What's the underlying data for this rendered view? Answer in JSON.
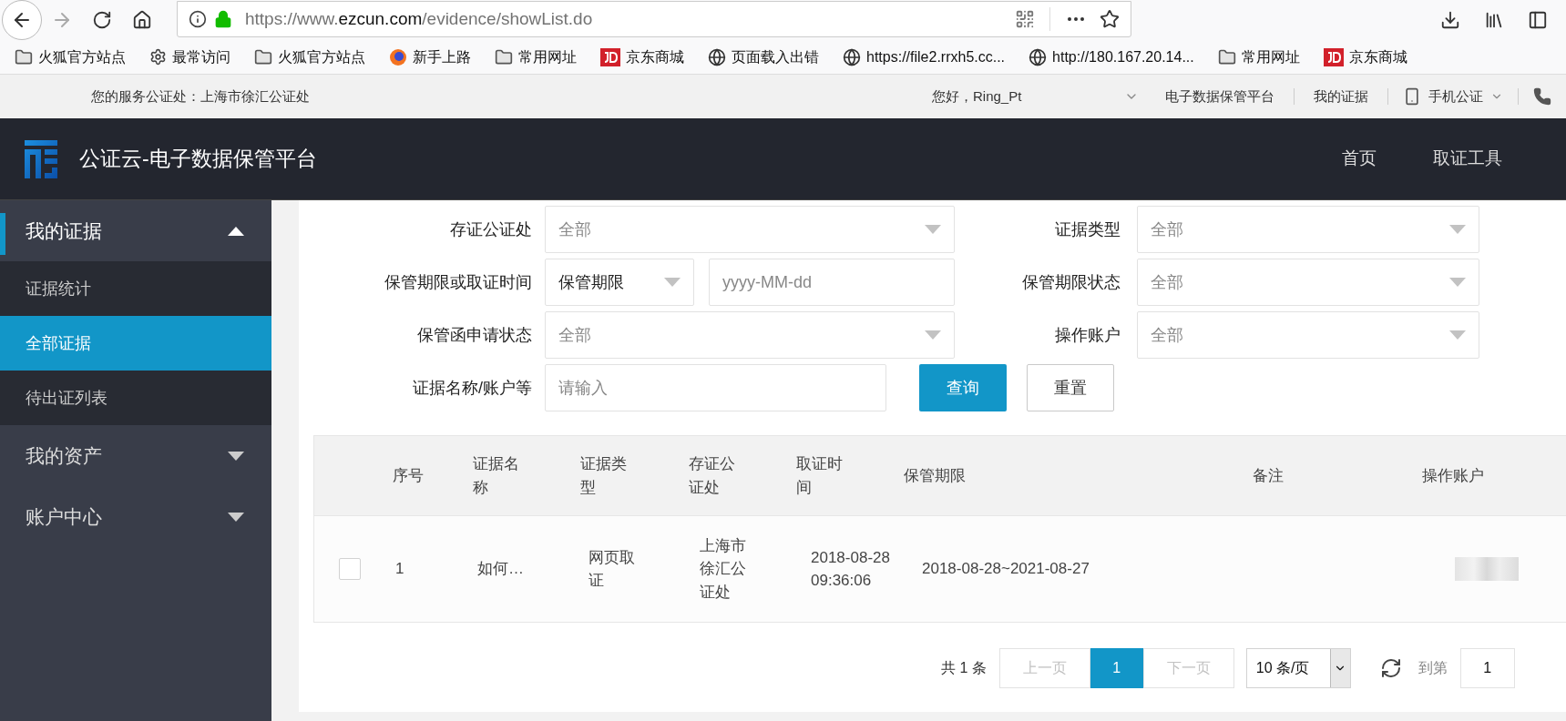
{
  "browser": {
    "back_enabled": true,
    "forward_enabled": false,
    "url": {
      "prefix": "https://www.",
      "domain": "ezcun.com",
      "path": "/evidence/showList.do"
    },
    "bookmarks": [
      {
        "kind": "folder",
        "label": "火狐官方站点"
      },
      {
        "kind": "gear",
        "label": "最常访问"
      },
      {
        "kind": "folder",
        "label": "火狐官方站点"
      },
      {
        "kind": "firefox",
        "label": "新手上路"
      },
      {
        "kind": "folder",
        "label": "常用网址"
      },
      {
        "kind": "jd",
        "label": "京东商城"
      },
      {
        "kind": "globe",
        "label": "页面载入出错"
      },
      {
        "kind": "globe",
        "label": "https://file2.rrxh5.cc..."
      },
      {
        "kind": "globe",
        "label": "http://180.167.20.14..."
      },
      {
        "kind": "folder",
        "label": "常用网址"
      },
      {
        "kind": "jd",
        "label": "京东商城"
      }
    ]
  },
  "topbar": {
    "service": "您的服务公证处：上海市徐汇公证处",
    "greeting": "您好，Ring_Pt",
    "links": [
      "电子数据保管平台",
      "我的证据"
    ],
    "mobile": "手机公证"
  },
  "header": {
    "title": "公证云-电子数据保管平台",
    "nav": [
      "首页",
      "取证工具"
    ]
  },
  "sidebar": [
    {
      "label": "我的证据",
      "expanded": true,
      "children": [
        {
          "label": "证据统计",
          "selected": false
        },
        {
          "label": "全部证据",
          "selected": true
        },
        {
          "label": "待出证列表",
          "selected": false
        }
      ]
    },
    {
      "label": "我的资产",
      "expanded": false
    },
    {
      "label": "账户中心",
      "expanded": false
    }
  ],
  "filters": [
    [
      {
        "label": "存证公证处",
        "kind": "select",
        "placeholder": "全部"
      },
      {
        "label": "证据类型",
        "kind": "select",
        "placeholder": "全部"
      }
    ],
    [
      {
        "label": "保管期限或取证时间",
        "kind": "combo",
        "value": "保管期限",
        "placeholder": "yyyy-MM-dd"
      },
      {
        "label": "保管期限状态",
        "kind": "select",
        "placeholder": "全部"
      }
    ],
    [
      {
        "label": "保管函申请状态",
        "kind": "select",
        "placeholder": "全部"
      },
      {
        "label": "操作账户",
        "kind": "select",
        "placeholder": "全部"
      }
    ],
    [
      {
        "label": "证据名称/账户等",
        "kind": "input",
        "placeholder": "请输入"
      }
    ]
  ],
  "buttons": [
    {
      "label": "查询",
      "primary": true
    },
    {
      "label": "重置",
      "primary": false
    }
  ],
  "table": {
    "columns": [
      "序号",
      "证据名称",
      "证据类型",
      "存证公证处",
      "取证时间",
      "保管期限",
      "备注",
      "操作账户"
    ],
    "rows": [
      {
        "checked": false,
        "cells": [
          "1",
          "如何…",
          "网页取证",
          "上海市徐汇公证处",
          "2018-08-28 09:36:06",
          "2018-08-28~2021-08-27"
        ],
        "account_redacted": true
      }
    ]
  },
  "pagination": {
    "total": "共 1 条",
    "prev": "上一页",
    "prev_disabled": true,
    "pages": [
      {
        "label": "1",
        "selected": true
      }
    ],
    "next": "下一页",
    "next_disabled": true,
    "page_size": "10 条/页",
    "goto_label": "到第",
    "goto_value": "1"
  }
}
